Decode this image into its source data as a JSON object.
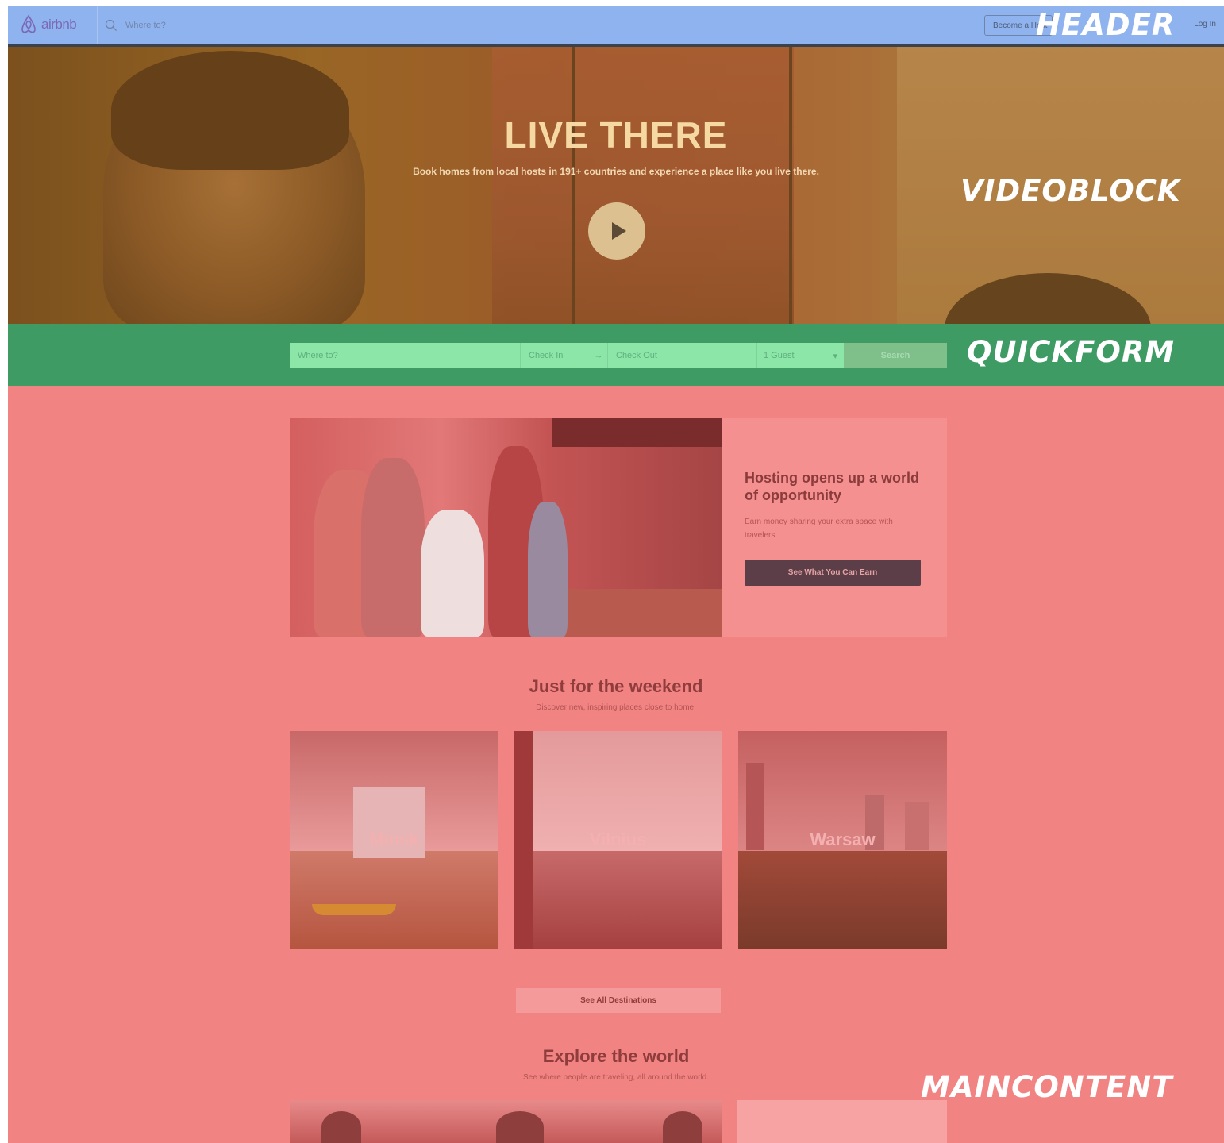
{
  "header": {
    "logo_text": "airbnb",
    "search_placeholder": "Where to?",
    "become_host_label": "Become a Host",
    "login_label": "Log In",
    "region_label": "HEADER"
  },
  "videoblock": {
    "title": "LIVE THERE",
    "subtitle": "Book homes from local hosts in 191+ countries and experience a place like you live there.",
    "region_label": "VIDEOBLOCK"
  },
  "quickform": {
    "where_placeholder": "Where to?",
    "check_in_placeholder": "Check In",
    "check_out_placeholder": "Check Out",
    "guests_value": "1 Guest",
    "search_label": "Search",
    "region_label": "QUICKFORM"
  },
  "main": {
    "host": {
      "title": "Hosting opens up a world of opportunity",
      "description": "Earn money sharing your extra space with travelers.",
      "button_label": "See What You Can Earn"
    },
    "weekend": {
      "title": "Just for the weekend",
      "subtitle": "Discover new, inspiring places close to home.",
      "destinations": [
        "Minsk",
        "Vilnius",
        "Warsaw"
      ]
    },
    "see_all_label": "See All Destinations",
    "explore": {
      "title": "Explore the world",
      "subtitle": "See where people are traveling, all around the world."
    },
    "region_label": "MAINCONTENT"
  }
}
